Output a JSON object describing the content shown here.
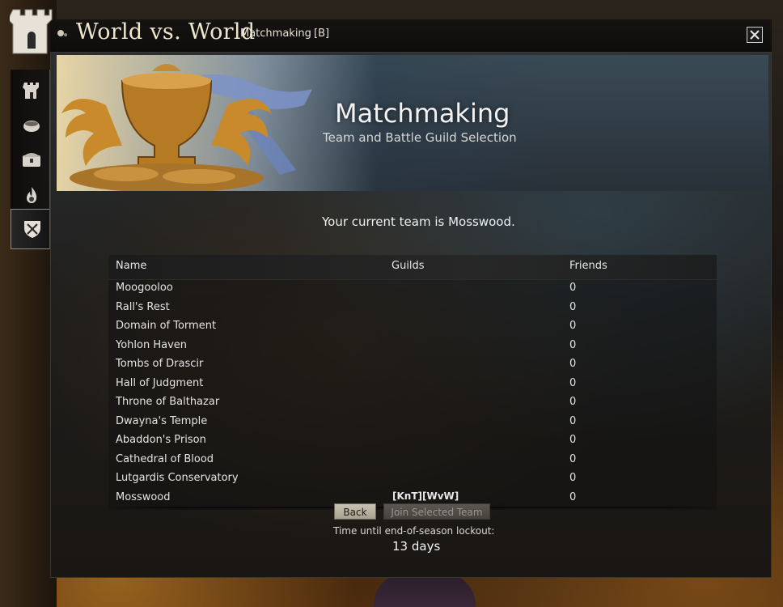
{
  "window": {
    "title": "World vs. World",
    "subtitle_tab": "Matchmaking",
    "hotkey": "[B]"
  },
  "sidenav": {
    "items": [
      {
        "icon": "castle-icon"
      },
      {
        "icon": "bowl-icon"
      },
      {
        "icon": "chest-icon"
      },
      {
        "icon": "flame-icon"
      },
      {
        "icon": "shield-swords-icon",
        "active": true
      }
    ]
  },
  "header": {
    "title": "Matchmaking",
    "subtitle": "Team and Battle Guild Selection"
  },
  "status": {
    "current_team": "Your current team is Mosswood."
  },
  "table": {
    "columns": [
      "Name",
      "Guilds",
      "Friends"
    ],
    "rows": [
      {
        "name": "Moogooloo",
        "guilds": "",
        "friends": "0"
      },
      {
        "name": "Rall's Rest",
        "guilds": "",
        "friends": "0"
      },
      {
        "name": "Domain of Torment",
        "guilds": "",
        "friends": "0"
      },
      {
        "name": "Yohlon Haven",
        "guilds": "",
        "friends": "0"
      },
      {
        "name": "Tombs of Drascir",
        "guilds": "",
        "friends": "0"
      },
      {
        "name": "Hall of Judgment",
        "guilds": "",
        "friends": "0"
      },
      {
        "name": "Throne of Balthazar",
        "guilds": "",
        "friends": "0"
      },
      {
        "name": "Dwayna's Temple",
        "guilds": "",
        "friends": "0"
      },
      {
        "name": "Abaddon's Prison",
        "guilds": "",
        "friends": "0"
      },
      {
        "name": "Cathedral of Blood",
        "guilds": "",
        "friends": "0"
      },
      {
        "name": "Lutgardis Conservatory",
        "guilds": "",
        "friends": "0"
      },
      {
        "name": "Mosswood",
        "guilds": "[KnT][WvW]",
        "friends": "0"
      }
    ]
  },
  "actions": {
    "back_label": "Back",
    "join_label": "Join Selected Team"
  },
  "lockout": {
    "label": "Time until end-of-season lockout:",
    "value": "13 days"
  },
  "colors": {
    "text": "#f0f0f0",
    "button_active": "#c9c1b1",
    "button_disabled": "#5b5852"
  }
}
